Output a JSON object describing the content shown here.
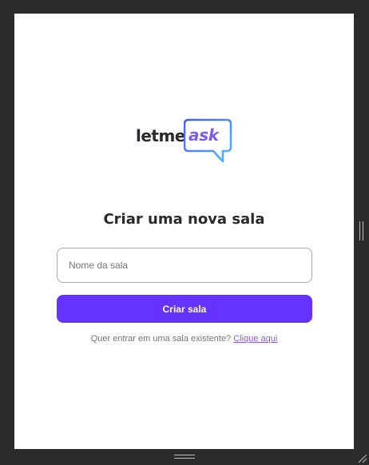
{
  "logo": {
    "word": "letme",
    "bubble_word": "ask",
    "icon": "speech-bubble-icon"
  },
  "page": {
    "title": "Criar uma nova sala"
  },
  "form": {
    "room_name_placeholder": "Nome da sala",
    "room_name_value": "",
    "create_button_label": "Criar sala"
  },
  "join": {
    "prompt": "Quer entrar em uma sala existente?",
    "link_label": "Clique aqui"
  },
  "colors": {
    "brand_purple": "#6433ff",
    "link_purple": "#835afd",
    "logo_gradient_start": "#485bff",
    "logo_gradient_end": "#4ebcf8"
  }
}
